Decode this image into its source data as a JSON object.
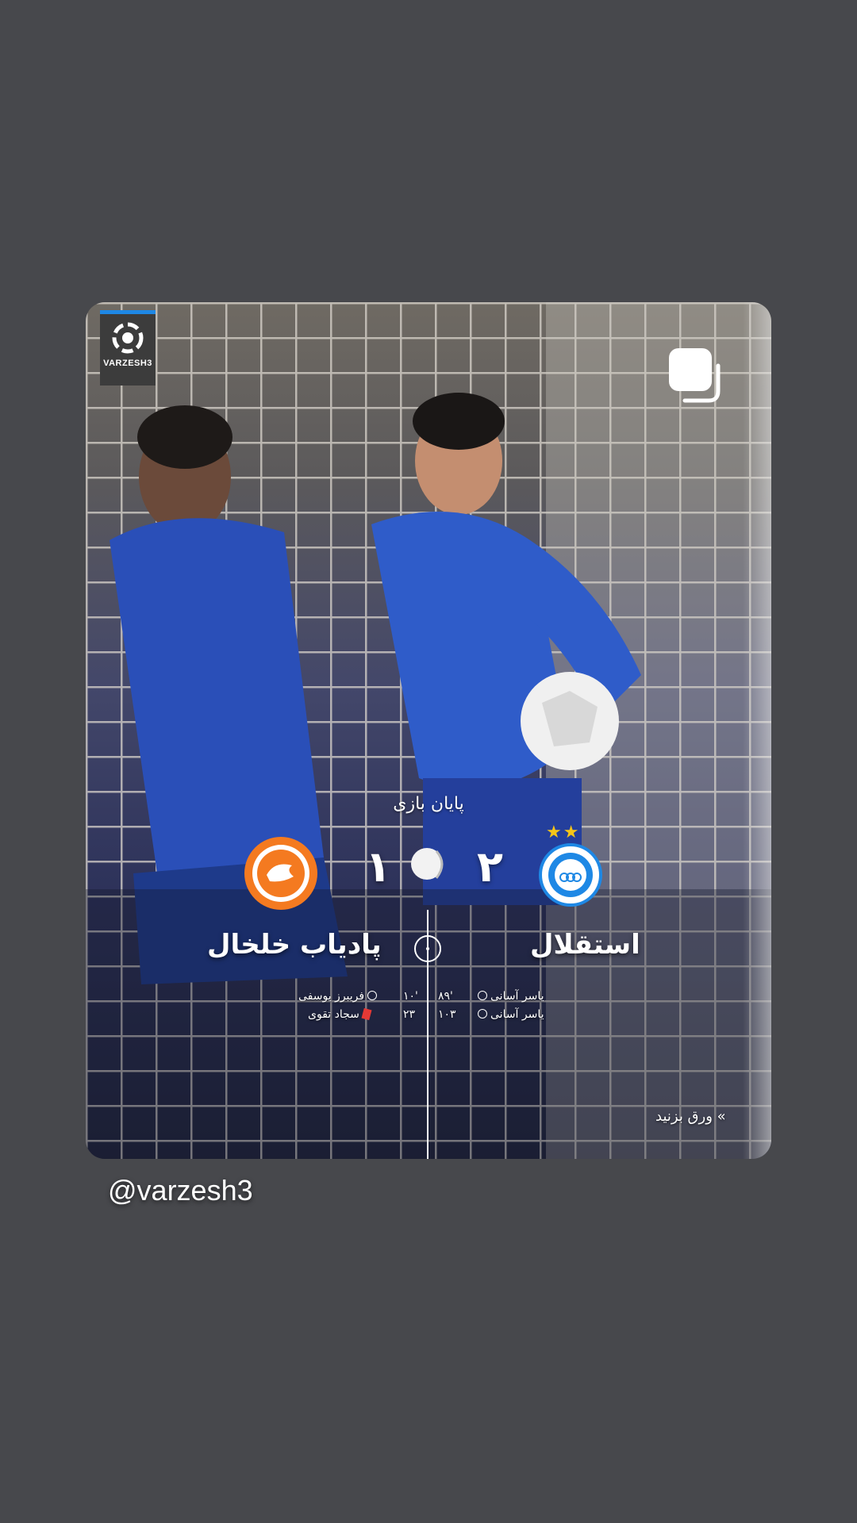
{
  "brand": {
    "logo_text": "VARZESH3",
    "accent": "#1e88e5"
  },
  "post": {
    "multi_icon": "carousel-multiple-icon",
    "status": "پایان بازی",
    "home": {
      "name": "استقلال",
      "score": "۲",
      "stars": "★★",
      "color": "#1e88e5",
      "events": [
        {
          "minute": "۸۹'",
          "player": "یاسر آسانی",
          "icon": "ball-icon"
        },
        {
          "minute": "۱۰۳",
          "player": "یاسر آسانی",
          "icon": "ball-icon"
        }
      ]
    },
    "away": {
      "name": "پادیاب خلخال",
      "score": "۱",
      "color": "#f47a20",
      "events": [
        {
          "minute": "۱۰'",
          "player": "فریبرز یوسفی",
          "icon": "ball-icon"
        },
        {
          "minute": "۲۳",
          "player": "سجاد تقوی",
          "icon": "red-card-icon"
        }
      ]
    },
    "competition_icon": "hazfi-cup-icon",
    "swipe_label": "ورق بزنید"
  },
  "story": {
    "handle": "@varzesh3"
  }
}
